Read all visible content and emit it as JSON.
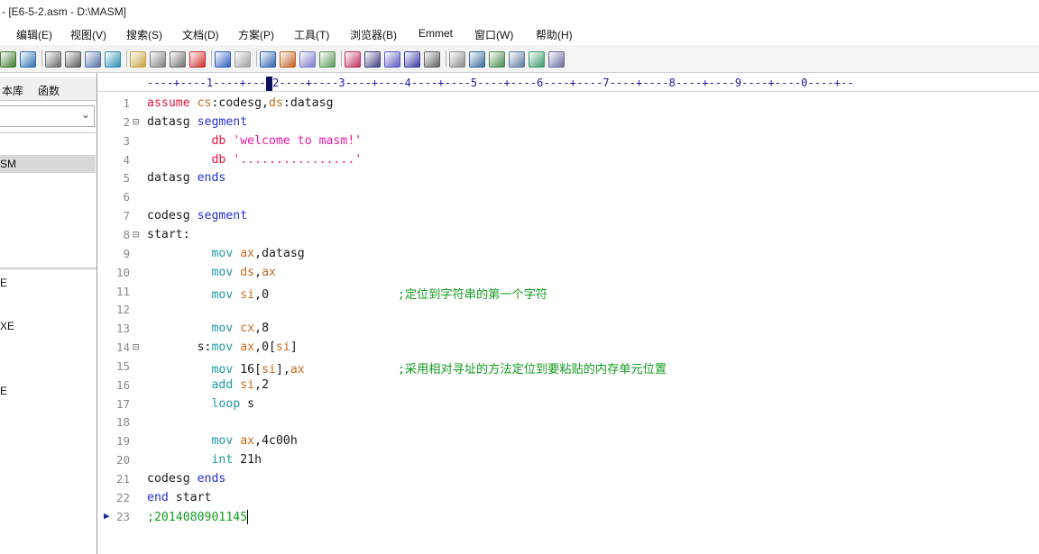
{
  "window": {
    "title": "- [E6-5-2.asm - D:\\MASM]"
  },
  "menu": [
    "编辑(E)",
    "视图(V)",
    "搜索(S)",
    "文档(D)",
    "方案(P)",
    "工具(T)",
    "浏览器(B)",
    "Emmet",
    "窗口(W)",
    "帮助(H)"
  ],
  "toolbar": {
    "icons": [
      "save-icon",
      "save-all-icon",
      "print-preview-icon",
      "print-icon",
      "spell-check-icon",
      "sync-icon",
      "cut-icon",
      "copy-icon",
      "paste-icon",
      "delete-icon",
      "undo-icon",
      "redo-icon",
      "find-icon",
      "replace-icon",
      "find-in-files-icon",
      "goto-icon",
      "font-icon",
      "hex-icon",
      "word-wrap-icon",
      "list-icon",
      "columns-icon",
      "settings-icon",
      "window-icon",
      "window2-icon",
      "window3-icon",
      "window4-icon",
      "help-icon"
    ]
  },
  "sidebar": {
    "tabs": [
      "本库",
      "函数"
    ],
    "selected_item": "SM",
    "files": [
      "E",
      "XE",
      "E"
    ]
  },
  "editor": {
    "ruler": "----+----1----+----2----+----3----+----4----+----5----+----6----+----7----+----8----+----9----+----0----+--",
    "lines": [
      {
        "n": "1",
        "parts": [
          [
            "kw-red",
            "assume "
          ],
          [
            "reg",
            "cs"
          ],
          [
            "plain",
            ":codesg,"
          ],
          [
            "reg",
            "ds"
          ],
          [
            "plain",
            ":datasg"
          ]
        ]
      },
      {
        "n": "2",
        "fold": true,
        "parts": [
          [
            "plain",
            "datasg "
          ],
          [
            "kw-blue",
            "segment"
          ]
        ]
      },
      {
        "n": "3",
        "parts": [
          [
            "plain",
            "         "
          ],
          [
            "kw-red",
            "db "
          ],
          [
            "str",
            "'welcome to masm!'"
          ]
        ]
      },
      {
        "n": "4",
        "parts": [
          [
            "plain",
            "         "
          ],
          [
            "kw-red",
            "db "
          ],
          [
            "str",
            "'................'"
          ]
        ]
      },
      {
        "n": "5",
        "parts": [
          [
            "plain",
            "datasg "
          ],
          [
            "kw-blue",
            "ends"
          ]
        ]
      },
      {
        "n": "6",
        "parts": []
      },
      {
        "n": "7",
        "parts": [
          [
            "plain",
            "codesg "
          ],
          [
            "kw-blue",
            "segment"
          ]
        ]
      },
      {
        "n": "8",
        "fold": true,
        "parts": [
          [
            "plain",
            "start:"
          ]
        ]
      },
      {
        "n": "9",
        "parts": [
          [
            "plain",
            "         "
          ],
          [
            "ins",
            "mov "
          ],
          [
            "reg",
            "ax"
          ],
          [
            "plain",
            ",datasg"
          ]
        ]
      },
      {
        "n": "10",
        "parts": [
          [
            "plain",
            "         "
          ],
          [
            "ins",
            "mov "
          ],
          [
            "reg",
            "ds"
          ],
          [
            "plain",
            ","
          ],
          [
            "reg",
            "ax"
          ]
        ]
      },
      {
        "n": "11",
        "parts": [
          [
            "plain",
            "         "
          ],
          [
            "ins",
            "mov "
          ],
          [
            "reg",
            "si"
          ],
          [
            "plain",
            ",0                  "
          ],
          [
            "cmt",
            ";定位到字符串的第一个字符"
          ]
        ]
      },
      {
        "n": "12",
        "parts": []
      },
      {
        "n": "13",
        "parts": [
          [
            "plain",
            "         "
          ],
          [
            "ins",
            "mov "
          ],
          [
            "reg",
            "cx"
          ],
          [
            "plain",
            ",8"
          ]
        ]
      },
      {
        "n": "14",
        "fold": true,
        "parts": [
          [
            "plain",
            "       s:"
          ],
          [
            "ins",
            "mov "
          ],
          [
            "reg",
            "ax"
          ],
          [
            "plain",
            ",0["
          ],
          [
            "reg",
            "si"
          ],
          [
            "plain",
            "]"
          ]
        ]
      },
      {
        "n": "15",
        "parts": [
          [
            "plain",
            "         "
          ],
          [
            "ins",
            "mov "
          ],
          [
            "plain",
            "16["
          ],
          [
            "reg",
            "si"
          ],
          [
            "plain",
            "],"
          ],
          [
            "reg",
            "ax"
          ],
          [
            "plain",
            "             "
          ],
          [
            "cmt",
            ";采用相对寻址的方法定位到要粘贴的内存单元位置"
          ]
        ]
      },
      {
        "n": "16",
        "parts": [
          [
            "plain",
            "         "
          ],
          [
            "ins",
            "add "
          ],
          [
            "reg",
            "si"
          ],
          [
            "plain",
            ",2"
          ]
        ]
      },
      {
        "n": "17",
        "parts": [
          [
            "plain",
            "         "
          ],
          [
            "ins",
            "loop "
          ],
          [
            "plain",
            "s"
          ]
        ]
      },
      {
        "n": "18",
        "parts": []
      },
      {
        "n": "19",
        "parts": [
          [
            "plain",
            "         "
          ],
          [
            "ins",
            "mov "
          ],
          [
            "reg",
            "ax"
          ],
          [
            "plain",
            ",4c00h"
          ]
        ]
      },
      {
        "n": "20",
        "parts": [
          [
            "plain",
            "         "
          ],
          [
            "ins",
            "int "
          ],
          [
            "plain",
            "21h"
          ]
        ]
      },
      {
        "n": "21",
        "parts": [
          [
            "plain",
            "codesg "
          ],
          [
            "kw-blue",
            "ends"
          ]
        ]
      },
      {
        "n": "22",
        "parts": [
          [
            "kw-blue",
            "end "
          ],
          [
            "plain",
            "start"
          ]
        ]
      },
      {
        "n": "23",
        "current": true,
        "parts": [
          [
            "cmt",
            ";2014080901145"
          ]
        ]
      }
    ]
  }
}
